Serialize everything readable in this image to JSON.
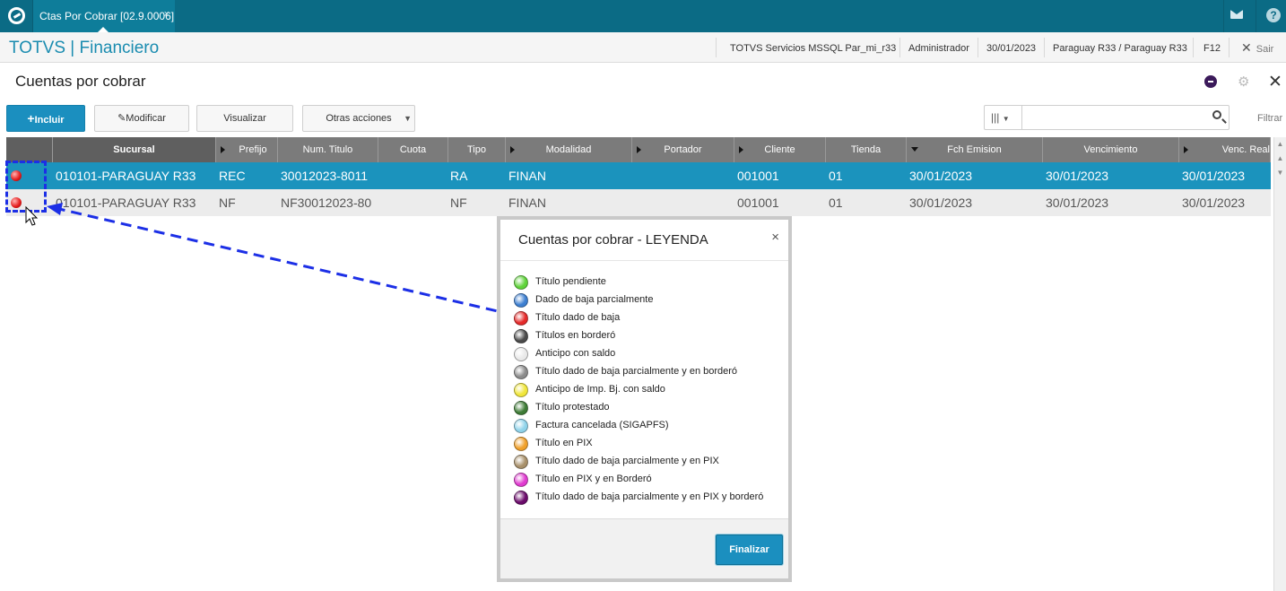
{
  "topbar": {
    "tab_label": "Ctas Por Cobrar [02.9.0006]",
    "tab_close": "×"
  },
  "header": {
    "brand": "TOTVS | Financiero",
    "environment": "TOTVS Servicios MSSQL Par_mi_r33",
    "user": "Administrador",
    "date": "30/01/2023",
    "branch": "Paraguay R33 / Paraguay R33",
    "shortcut": "F12",
    "exit_label": "Sair"
  },
  "page": {
    "title": "Cuentas por cobrar"
  },
  "toolbar": {
    "incluir": "Incluir",
    "modificar": "Modificar",
    "visualizar": "Visualizar",
    "otras": "Otras acciones",
    "filter_label": "Filtrar",
    "search_placeholder": ""
  },
  "grid": {
    "headers": [
      "Sucursal",
      "Prefijo",
      "Num. Titulo",
      "Cuota",
      "Tipo",
      "Modalidad",
      "Portador",
      "Cliente",
      "Tienda",
      "Fch Emision",
      "Vencimiento",
      "Venc. Real"
    ],
    "rows": [
      {
        "sucursal": "010101-PARAGUAY R33",
        "prefijo": "REC",
        "num": "30012023-8011",
        "cuota": "",
        "tipo": "RA",
        "modalidad": "FINAN",
        "portador": "",
        "cliente": "001001",
        "tienda": "01",
        "emision": "30/01/2023",
        "venc": "30/01/2023",
        "vreal": "30/01/2023",
        "status": "Titulo dado de baja"
      },
      {
        "sucursal": "010101-PARAGUAY R33",
        "prefijo": "NF",
        "num": "NF30012023-80",
        "cuota": "",
        "tipo": "NF",
        "modalidad": "FINAN",
        "portador": "",
        "cliente": "001001",
        "tienda": "01",
        "emision": "30/01/2023",
        "venc": "30/01/2023",
        "vreal": "30/01/2023",
        "status": "Titulo dado de baja"
      }
    ]
  },
  "legend": {
    "title": "Cuentas por cobrar - LEYENDA",
    "close": "×",
    "finalize": "Finalizar",
    "items": [
      {
        "label": "Título pendiente",
        "color": "#5fd33a"
      },
      {
        "label": "Dado de baja parcialmente",
        "color": "#3d7fd1"
      },
      {
        "label": "Título dado de baja",
        "color": "#e52a2a"
      },
      {
        "label": "Títulos en borderó",
        "color": "#4a4a4a"
      },
      {
        "label": "Anticipo con saldo",
        "color": "#e9e9e9"
      },
      {
        "label": "Título dado de baja parcialmente y en borderó",
        "color": "#8b8b8b"
      },
      {
        "label": "Anticipo de Imp. Bj. con saldo",
        "color": "#f0e63a"
      },
      {
        "label": "Título protestado",
        "color": "#3d7b35"
      },
      {
        "label": "Factura cancelada (SIGAPFS)",
        "color": "#8fd3ea"
      },
      {
        "label": "Título en PIX",
        "color": "#f0a02a"
      },
      {
        "label": "Título dado de baja parcialmente y en PIX",
        "color": "#a8906a"
      },
      {
        "label": "Título en PIX y en Borderó",
        "color": "#e03bd0"
      },
      {
        "label": "Título dado de baja parcialmente y en PIX y borderó",
        "color": "#6b0b6b"
      }
    ]
  }
}
